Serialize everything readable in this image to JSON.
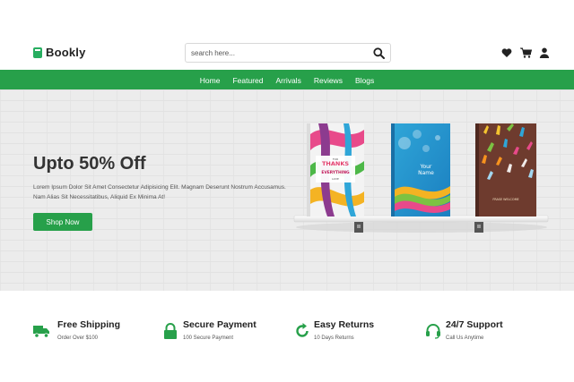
{
  "brand": {
    "name": "Bookly",
    "accent": "#27a04a"
  },
  "search": {
    "placeholder": "search here..."
  },
  "header_icons": [
    "heart-icon",
    "cart-icon",
    "user-icon"
  ],
  "nav": {
    "items": [
      "Home",
      "Featured",
      "Arrivals",
      "Reviews",
      "Blogs"
    ]
  },
  "hero": {
    "title": "Upto 50% Off",
    "text": "Lorem Ipsum Dolor Sit Amet Consectetur Adipisicing Elit. Magnam Deserunt Nostrum Accusamus. Nam Alias Sit Necessitatibus, Aliquid Ex Minima At!",
    "button": "Shop Now"
  },
  "books": [
    {
      "line1": "THANKS",
      "line2": "EVERYTHING",
      "line3": "FOR",
      "line4": "LOVE"
    },
    {
      "line1": "Your",
      "line2": "Name"
    },
    {
      "line1": "FRASE WELCOME"
    }
  ],
  "features": [
    {
      "icon": "truck-icon",
      "title": "Free Shipping",
      "sub": "Order Over $100"
    },
    {
      "icon": "lock-icon",
      "title": "Secure Payment",
      "sub": "100 Secure Payment"
    },
    {
      "icon": "return-icon",
      "title": "Easy Returns",
      "sub": "10 Days Returns"
    },
    {
      "icon": "headset-icon",
      "title": "24/7 Support",
      "sub": "Call Us Anytime"
    }
  ]
}
